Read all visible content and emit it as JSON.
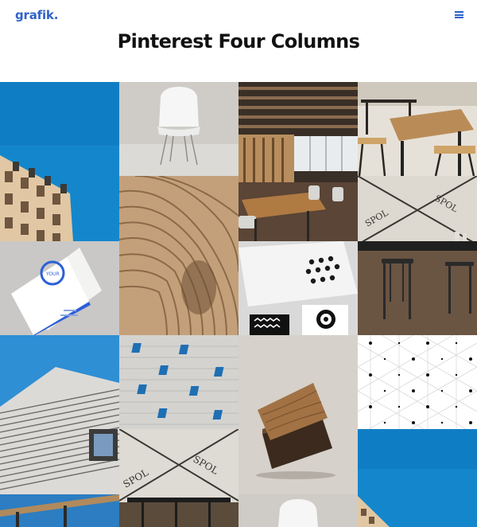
{
  "header": {
    "logo": "grafik.",
    "menu_icon": "hamburger-icon"
  },
  "page": {
    "title": "Pinterest Four Columns"
  },
  "gallery": {
    "columns": 4,
    "items": [
      {
        "subject": "building-facade-blue-sky"
      },
      {
        "subject": "white-chair-concrete"
      },
      {
        "subject": "restaurant-interior"
      },
      {
        "subject": "cafe-tables"
      },
      {
        "subject": "wood-slat-sculpture"
      },
      {
        "subject": "spol-poster-black-chairs"
      },
      {
        "subject": "business-cards"
      },
      {
        "subject": "dots-stationery"
      },
      {
        "subject": "striped-building"
      },
      {
        "subject": "brick-wall-blue-tiles"
      },
      {
        "subject": "wooden-blocks"
      },
      {
        "subject": "dot-grid-pattern"
      },
      {
        "subject": "spol-poster-bar-stools"
      },
      {
        "subject": "blue-building"
      },
      {
        "subject": "cafe-tables-blue"
      },
      {
        "subject": "white-chair-concrete"
      }
    ]
  },
  "colors": {
    "accent": "#2f62c8",
    "sky": "#1e8ad0",
    "wood": "#c9a370",
    "concrete": "#cfccc7"
  }
}
